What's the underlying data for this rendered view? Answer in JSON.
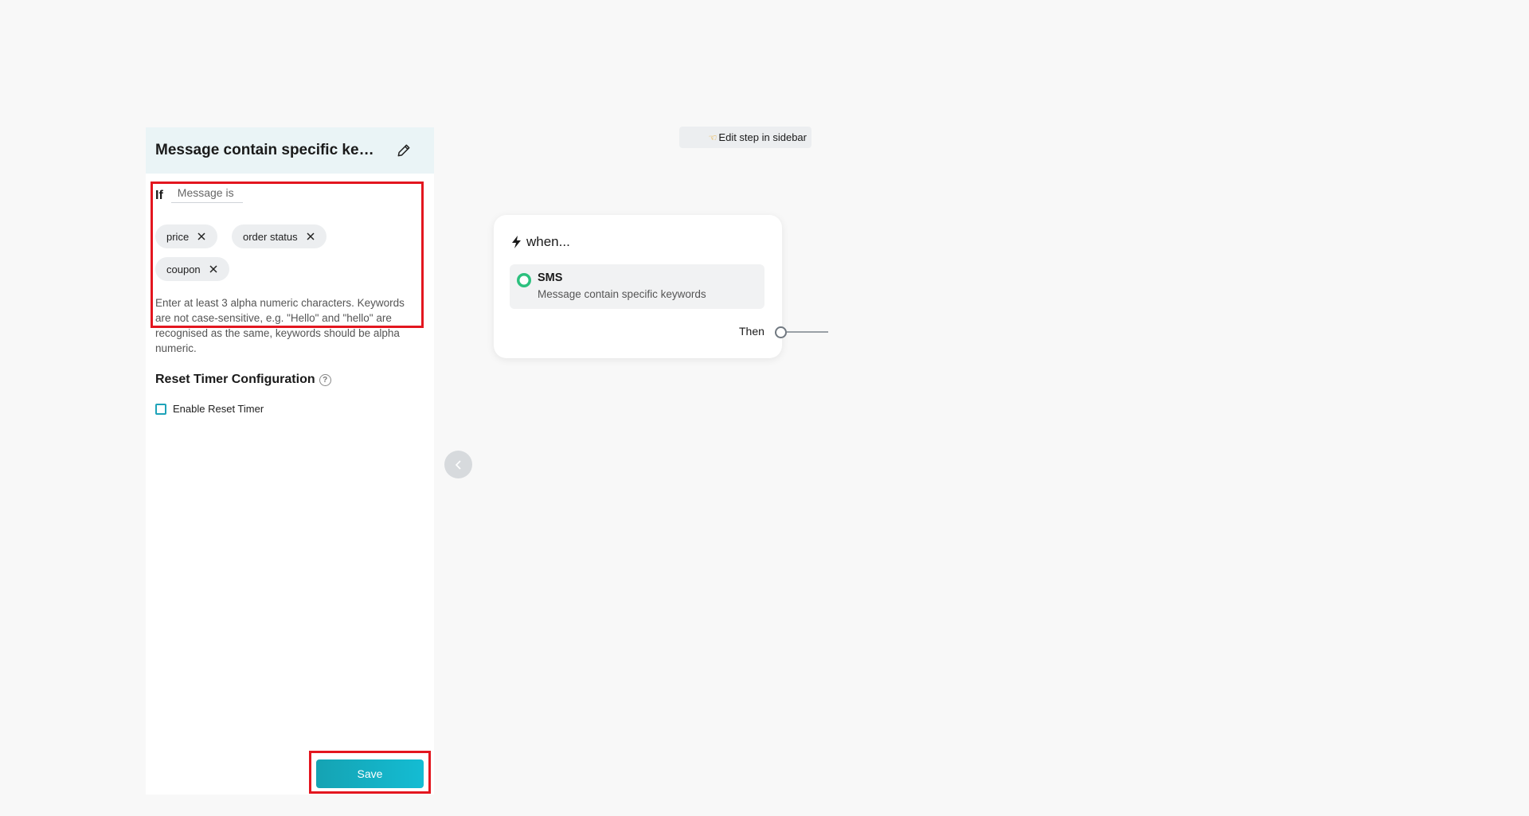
{
  "sidebar": {
    "title": "Message contain specific keyw...",
    "condition": {
      "if_label": "If",
      "operator_value": "Message is"
    },
    "keywords": [
      "price",
      "order status",
      "coupon"
    ],
    "helper_text": "Enter at least 3 alpha numeric characters. Keywords are not case-sensitive, e.g. \"Hello\" and \"hello\" are recognised as the same, keywords should be alpha numeric.",
    "reset_timer": {
      "title": "Reset Timer Configuration",
      "help_glyph": "?",
      "checkbox_label": "Enable Reset Timer",
      "checked": false
    },
    "save_label": "Save"
  },
  "canvas": {
    "hint": "Edit step in sidebar",
    "node": {
      "header": "when...",
      "trigger_title": "SMS",
      "trigger_subtitle": "Message contain specific keywords",
      "then_label": "Then"
    }
  },
  "colors": {
    "accent": "#14b1c4",
    "highlight": "#e3161f",
    "sms_green": "#2cc07e"
  }
}
